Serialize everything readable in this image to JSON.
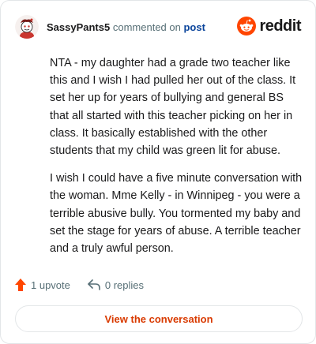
{
  "header": {
    "username": "SassyPants5",
    "verb": "commented on",
    "post_link": "post"
  },
  "brand": {
    "name": "reddit",
    "color": "#ff4500"
  },
  "comment": {
    "paragraphs": [
      "NTA - my daughter had a grade two teacher like this and I wish I had pulled her out of the class. It set her up for years of bullying and general BS that all started with this teacher picking on her in class. It basically established with the other students that my child was green lit for abuse.",
      "I wish I could have a five minute conversation with the woman. Mme Kelly - in Winnipeg - you were a terrible abusive bully. You tormented my baby and set the stage for years of abuse. A terrible teacher and a truly awful person."
    ]
  },
  "actions": {
    "upvote_label": "1 upvote",
    "replies_label": "0 replies"
  },
  "cta": {
    "label": "View the conversation"
  },
  "icons": {
    "avatar": "snoo-avatar-icon",
    "logo": "reddit-logo-icon",
    "upvote": "upvote-arrow-icon",
    "reply": "reply-arrow-icon"
  }
}
